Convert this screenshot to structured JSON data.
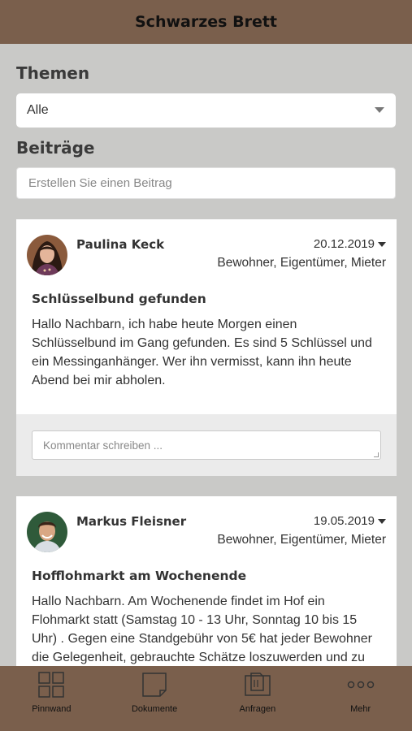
{
  "header": {
    "title": "Schwarzes Brett"
  },
  "topics": {
    "label": "Themen",
    "selected": "Alle"
  },
  "posts_section": {
    "label": "Beiträge",
    "create_placeholder": "Erstellen Sie einen Beitrag"
  },
  "posts": [
    {
      "author": "Paulina Keck",
      "date": "20.12.2019",
      "audience": "Bewohner, Eigentümer, Mieter",
      "title": "Schlüsselbund gefunden",
      "body": "Hallo Nachbarn, ich habe heute Morgen einen Schlüsselbund im Gang gefunden. Es sind 5 Schlüssel und ein Messinganhänger. Wer ihn vermisst, kann ihn heute Abend bei mir abholen.",
      "comment_placeholder": "Kommentar schreiben ..."
    },
    {
      "author": "Markus Fleisner",
      "date": "19.05.2019",
      "audience": "Bewohner, Eigentümer, Mieter",
      "title": "Hofflohmarkt am Wochenende",
      "body": "Hallo Nachbarn. Am Wochenende findet im Hof ein Flohmarkt statt (Samstag 10 - 13 Uhr, Sonntag 10 bis 15 Uhr) . Gegen eine Standgebühr von 5€ hat jeder Bewohner die Gelegenheit, gebrauchte Schätze loszuwerden und zu"
    }
  ],
  "tabbar": {
    "items": [
      {
        "label": "Pinnwand",
        "icon": "grid-icon"
      },
      {
        "label": "Dokumente",
        "icon": "document-icon"
      },
      {
        "label": "Anfragen",
        "icon": "inbox-icon"
      },
      {
        "label": "Mehr",
        "icon": "more-icon"
      }
    ]
  },
  "colors": {
    "header": "#7a5f4c",
    "background": "#c9c9c7",
    "card": "#ffffff"
  }
}
